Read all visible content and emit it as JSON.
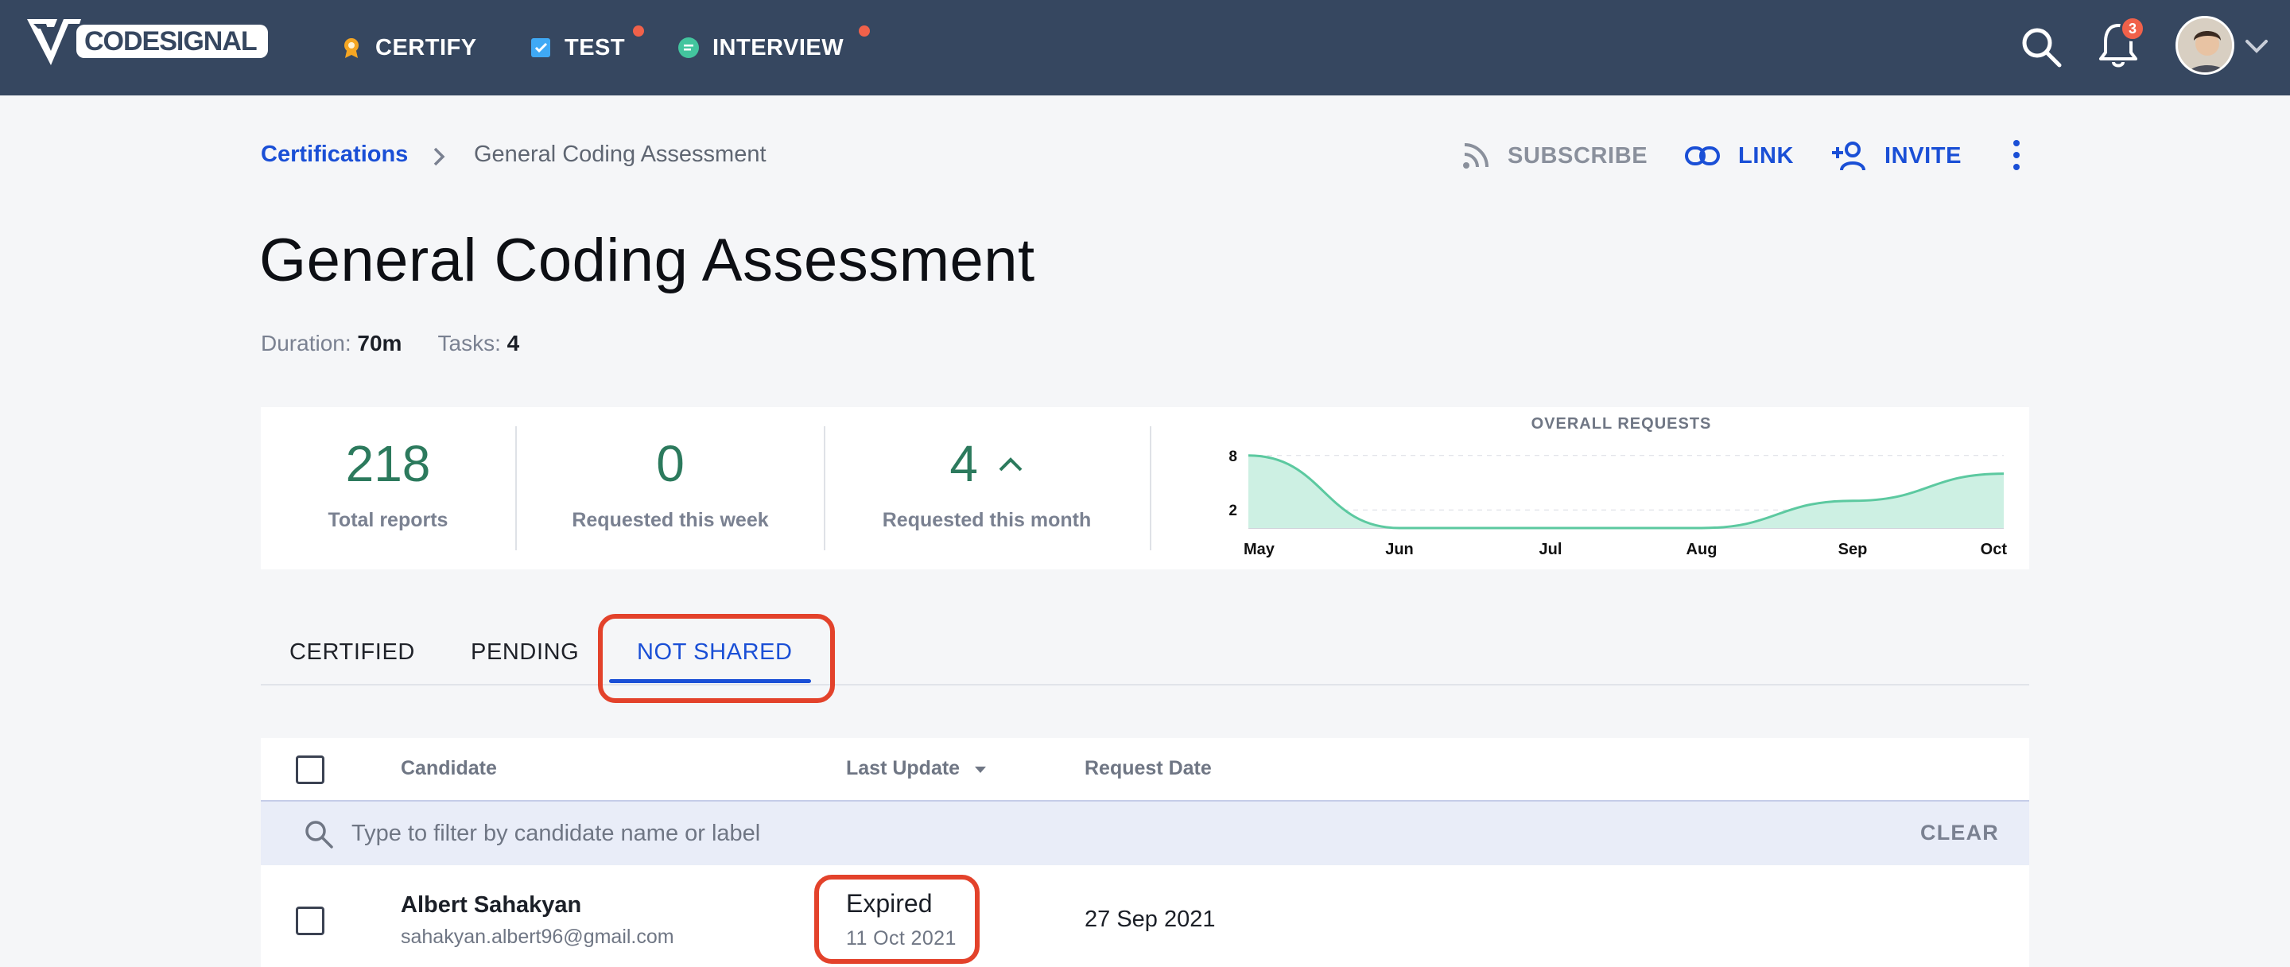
{
  "app": {
    "logo_text": "CODESIGNAL"
  },
  "nav": {
    "items": [
      {
        "label": "CERTIFY",
        "icon": "badge-icon"
      },
      {
        "label": "TEST",
        "icon": "checklist-icon"
      },
      {
        "label": "INTERVIEW",
        "icon": "chat-icon"
      }
    ],
    "notification_count": "3"
  },
  "breadcrumb": {
    "parent": "Certifications",
    "current": "General Coding Assessment"
  },
  "actions": {
    "subscribe": "SUBSCRIBE",
    "link": "LINK",
    "invite": "INVITE"
  },
  "page": {
    "title": "General Coding Assessment",
    "duration_label": "Duration:",
    "duration_value": "70m",
    "tasks_label": "Tasks:",
    "tasks_value": "4"
  },
  "stats": {
    "total_reports": {
      "value": "218",
      "label": "Total reports"
    },
    "requested_week": {
      "value": "0",
      "label": "Requested this week"
    },
    "requested_month": {
      "value": "4",
      "label": "Requested this month"
    }
  },
  "chart_data": {
    "type": "area",
    "title": "OVERALL REQUESTS",
    "x": [
      "May",
      "Jun",
      "Jul",
      "Aug",
      "Sep",
      "Oct"
    ],
    "series": [
      {
        "values": [
          8,
          0,
          0,
          0,
          3,
          6
        ]
      }
    ],
    "yticks": [
      2,
      8
    ],
    "ylim": [
      0,
      10
    ],
    "color": "#5cc9a0",
    "fill": "#cdf0e3"
  },
  "tabs": [
    {
      "label": "CERTIFIED",
      "active": false
    },
    {
      "label": "PENDING",
      "active": false
    },
    {
      "label": "NOT SHARED",
      "active": true
    }
  ],
  "table": {
    "columns": {
      "candidate": "Candidate",
      "last_update": "Last Update",
      "request_date": "Request Date"
    },
    "filter_placeholder": "Type to filter by candidate name or label",
    "clear_label": "CLEAR",
    "rows": [
      {
        "name": "Albert Sahakyan",
        "email": "sahakyan.albert96@gmail.com",
        "status": "Expired",
        "status_date": "11 Oct 2021",
        "request_date": "27 Sep 2021"
      }
    ]
  },
  "colors": {
    "topbar": "#364760",
    "accent": "#1a4fd6",
    "stat": "#2c7a5d",
    "highlight": "#e3422b",
    "notification": "#f0614a"
  }
}
